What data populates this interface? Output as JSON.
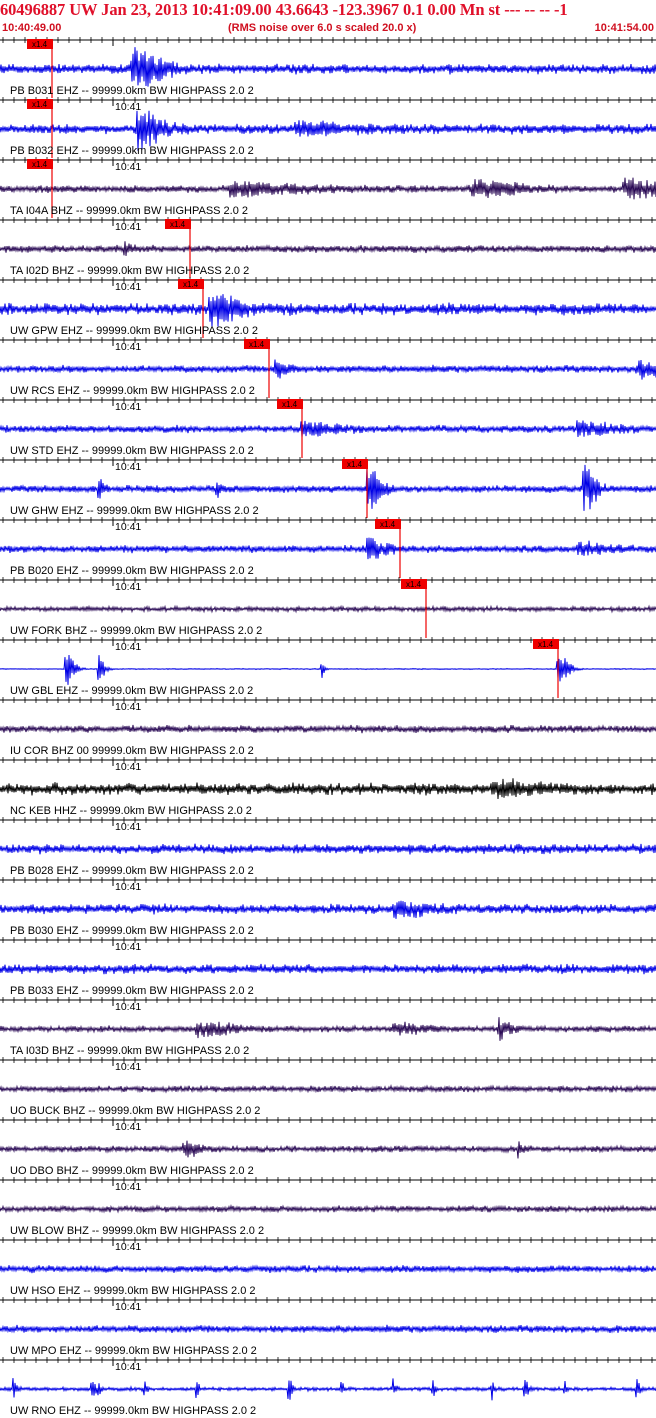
{
  "header": {
    "title": "60496887 UW Jan 23, 2013 10:41:09.00   43.6643 -123.3967  0.1 0.00 Mn st --- -- --   -1",
    "start_time": "10:40:49.00",
    "end_time": "10:41:54.00",
    "note": "(RMS noise over 6.0 s scaled 20.0 x)"
  },
  "colors": {
    "title": "#e0102a",
    "pick": "#ee0000",
    "trace_blue": "#0000e6",
    "trace_purple": "#2a0a55",
    "trace_black": "#000000"
  },
  "tick_label": "10:41",
  "pick_label": "x1.4",
  "channels": [
    {
      "label": "PB B031 EHZ -- 99999.0km BW  HIGHPASS  2.0  2",
      "color": "blue",
      "pick": 0.08,
      "amp": 4,
      "bursts": [
        [
          0.2,
          20,
          28
        ]
      ]
    },
    {
      "label": "PB B032 EHZ -- 99999.0km BW  HIGHPASS  2.0  2",
      "color": "blue",
      "pick": 0.08,
      "amp": 4,
      "bursts": [
        [
          0.21,
          18,
          22
        ],
        [
          0.45,
          5,
          50
        ]
      ]
    },
    {
      "label": "TA I04A BHZ -- 99999.0km BW  HIGHPASS  2.0  2",
      "color": "purple",
      "pick": 0.08,
      "amp": 3,
      "bursts": [
        [
          0.35,
          6,
          60
        ],
        [
          0.72,
          8,
          40
        ],
        [
          0.95,
          9,
          40
        ]
      ]
    },
    {
      "label": "TA I02D BHZ -- 99999.0km BW  HIGHPASS  2.0  2",
      "color": "purple",
      "pick": 0.29,
      "amp": 3,
      "bursts": [
        [
          0.19,
          5,
          8
        ]
      ]
    },
    {
      "label": "UW GPW EHZ -- 99999.0km BW  HIGHPASS  2.0  2",
      "color": "blue",
      "pick": 0.31,
      "amp": 5,
      "bursts": [
        [
          0.32,
          18,
          20
        ]
      ]
    },
    {
      "label": "UW RCS EHZ -- 99999.0km BW  HIGHPASS  2.0  2",
      "color": "blue",
      "pick": 0.41,
      "amp": 3,
      "bursts": [
        [
          0.42,
          10,
          12
        ],
        [
          0.97,
          8,
          25
        ]
      ]
    },
    {
      "label": "UW STD EHZ -- 99999.0km BW  HIGHPASS  2.0  2",
      "color": "blue",
      "pick": 0.46,
      "amp": 3,
      "bursts": [
        [
          0.46,
          7,
          30
        ],
        [
          0.88,
          6,
          35
        ]
      ]
    },
    {
      "label": "UW GHW EHZ -- 99999.0km BW  HIGHPASS  2.0  2",
      "color": "blue",
      "pick": 0.56,
      "amp": 3,
      "bursts": [
        [
          0.56,
          25,
          12
        ],
        [
          0.89,
          22,
          12
        ],
        [
          0.15,
          12,
          4
        ],
        [
          0.33,
          10,
          4
        ]
      ]
    },
    {
      "label": "PB B020 EHZ -- 99999.0km BW  HIGHPASS  2.0  2",
      "color": "blue",
      "pick": 0.61,
      "amp": 3,
      "bursts": [
        [
          0.56,
          10,
          18
        ],
        [
          0.88,
          6,
          25
        ]
      ]
    },
    {
      "label": "UW FORK BHZ -- 99999.0km BW  HIGHPASS  2.0  2",
      "color": "purple",
      "pick": 0.65,
      "amp": 2,
      "bursts": []
    },
    {
      "label": "UW GBL EHZ -- 99999.0km BW  HIGHPASS  2.0  2",
      "color": "blue",
      "pick": 0.85,
      "amp": 0.4,
      "bursts": [
        [
          0.1,
          18,
          8
        ],
        [
          0.15,
          14,
          6
        ],
        [
          0.49,
          12,
          3
        ],
        [
          0.85,
          18,
          10
        ]
      ]
    },
    {
      "label": "IU COR BHZ 00 99999.0km BW  HIGHPASS  2.0  2",
      "color": "purple",
      "pick": null,
      "amp": 3,
      "bursts": []
    },
    {
      "label": "NC KEB HHZ -- 99999.0km BW  HIGHPASS  2.0  2",
      "color": "black",
      "pick": null,
      "amp": 5,
      "bursts": [
        [
          0.75,
          7,
          30
        ]
      ]
    },
    {
      "label": "PB B028 EHZ -- 99999.0km BW  HIGHPASS  2.0  2",
      "color": "blue",
      "pick": null,
      "amp": 4,
      "bursts": []
    },
    {
      "label": "PB B030 EHZ -- 99999.0km BW  HIGHPASS  2.0  2",
      "color": "blue",
      "pick": null,
      "amp": 4,
      "bursts": [
        [
          0.6,
          6,
          30
        ]
      ]
    },
    {
      "label": "PB B033 EHZ -- 99999.0km BW  HIGHPASS  2.0  2",
      "color": "blue",
      "pick": null,
      "amp": 4,
      "bursts": []
    },
    {
      "label": "TA I03D BHZ -- 99999.0km BW  HIGHPASS  2.0  2",
      "color": "purple",
      "pick": null,
      "amp": 2.5,
      "bursts": [
        [
          0.3,
          7,
          35
        ],
        [
          0.76,
          10,
          10
        ],
        [
          0.6,
          5,
          30
        ]
      ]
    },
    {
      "label": "UO BUCK BHZ -- 99999.0km BW  HIGHPASS  2.0  2",
      "color": "purple",
      "pick": null,
      "amp": 2.5,
      "bursts": []
    },
    {
      "label": "UO DBO BHZ -- 99999.0km BW  HIGHPASS  2.0  2",
      "color": "purple",
      "pick": null,
      "amp": 2.5,
      "bursts": [
        [
          0.28,
          8,
          14
        ],
        [
          0.79,
          10,
          4
        ]
      ]
    },
    {
      "label": "UW BLOW BHZ -- 99999.0km BW  HIGHPASS  2.0  2",
      "color": "purple",
      "pick": null,
      "amp": 2.5,
      "bursts": []
    },
    {
      "label": "UW HSO EHZ -- 99999.0km BW  HIGHPASS  2.0  2",
      "color": "blue",
      "pick": null,
      "amp": 3,
      "bursts": []
    },
    {
      "label": "UW MPO EHZ -- 99999.0km BW  HIGHPASS  2.0  2",
      "color": "blue",
      "pick": null,
      "amp": 3,
      "bursts": []
    },
    {
      "label": "UW RNO EHZ -- 99999.0km BW  HIGHPASS  2.0  2",
      "color": "blue",
      "pick": null,
      "amp": 1.5,
      "bursts": [
        [
          0.02,
          12,
          3
        ],
        [
          0.14,
          10,
          3
        ],
        [
          0.15,
          9,
          2
        ],
        [
          0.22,
          11,
          2
        ],
        [
          0.3,
          9,
          2
        ],
        [
          0.44,
          12,
          3
        ],
        [
          0.52,
          8,
          2
        ],
        [
          0.6,
          9,
          2
        ],
        [
          0.66,
          8,
          2
        ],
        [
          0.75,
          10,
          2
        ],
        [
          0.8,
          12,
          3
        ],
        [
          0.86,
          9,
          2
        ],
        [
          0.97,
          10,
          3
        ]
      ]
    }
  ]
}
